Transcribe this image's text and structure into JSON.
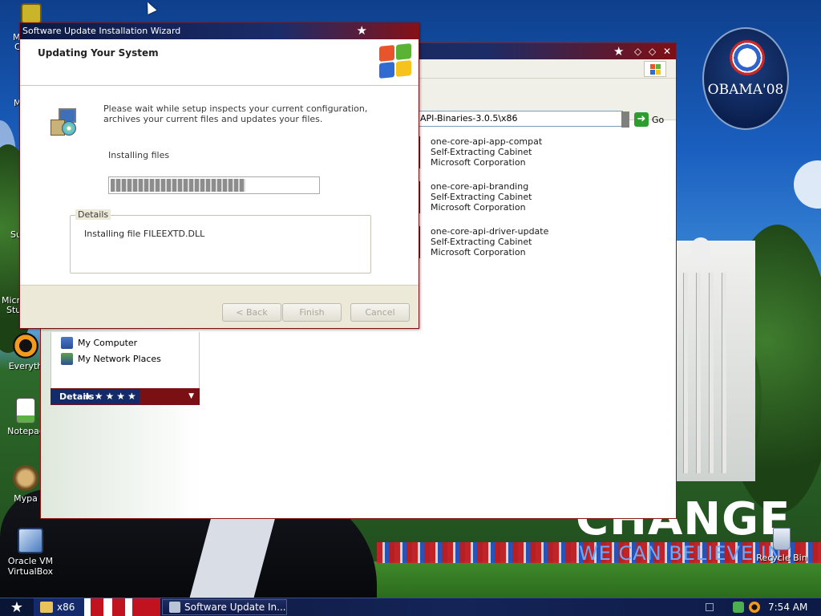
{
  "desktop": {
    "wallpaper": {
      "logo_text": "OBAMA'08",
      "headline": "CHANGE",
      "tagline": "WE CAN BELIEVE IN"
    },
    "icons": [
      {
        "label": "Everyth",
        "icon": "everything-search-icon"
      },
      {
        "label": "Notepac",
        "icon": "notepad-icon"
      },
      {
        "label": "Mypa",
        "icon": "mypaint-icon"
      },
      {
        "label": "Oracle VM VirtualBox",
        "icon": "virtualbox-icon"
      },
      {
        "label": "Recycle Bin",
        "icon": "recycle-bin-icon"
      }
    ],
    "clipped_labels": [
      "M",
      "C",
      "M",
      "Su",
      "Micro",
      "Stu"
    ]
  },
  "explorer": {
    "address_value": "API-Binaries-3.0.5\\x86",
    "go_label": "Go",
    "places": [
      {
        "label": "My Computer",
        "icon": "my-computer-icon"
      },
      {
        "label": "My Network Places",
        "icon": "network-places-icon"
      }
    ],
    "details_label": "Details",
    "files": [
      {
        "name": "one-core-api-app-compat",
        "type": "Self-Extracting Cabinet",
        "company": "Microsoft Corporation"
      },
      {
        "name": "one-core-api-branding",
        "type": "Self-Extracting Cabinet",
        "company": "Microsoft Corporation"
      },
      {
        "name": "one-core-api-driver-update",
        "type": "Self-Extracting Cabinet",
        "company": "Microsoft Corporation"
      }
    ]
  },
  "wizard": {
    "title": "Software Update Installation Wizard",
    "heading": "Updating Your System",
    "message": "Please wait while setup inspects your current configuration, archives your current files and updates your files.",
    "status": "Installing files",
    "progress": 0.65,
    "details_legend": "Details",
    "details_text": "Installing file FILEEXTD.DLL",
    "buttons": {
      "back": "< Back",
      "finish": "Finish",
      "cancel": "Cancel"
    }
  },
  "taskbar": {
    "items": [
      {
        "label": "x86",
        "icon": "folder-icon"
      }
    ],
    "active_button": "Software Update In...",
    "clock": "7:54 AM"
  },
  "colors": {
    "title_blue": "#1b2c6a",
    "title_red": "#861117",
    "dialog_bg": "#ece9d8",
    "go_green": "#2f9c2f"
  }
}
